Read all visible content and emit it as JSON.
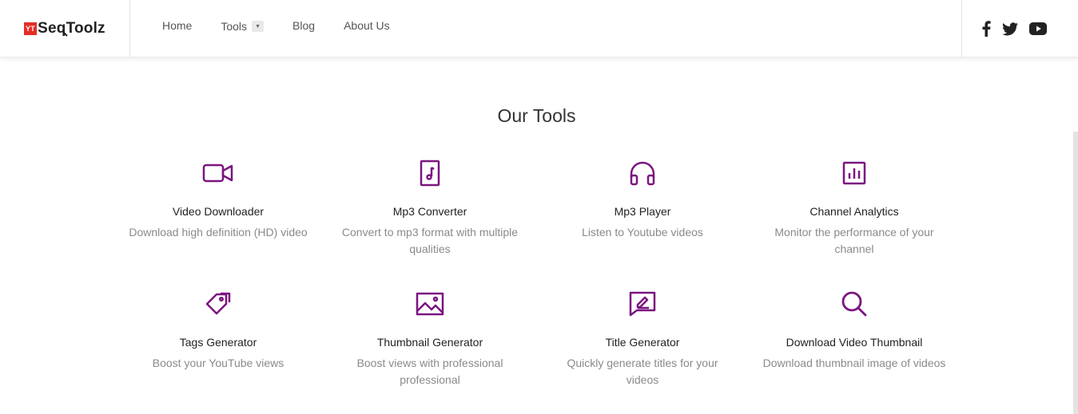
{
  "brand": {
    "badge": "YT",
    "name_start": "Se",
    "name_q": "q",
    "name_end": "Toolz"
  },
  "nav": {
    "home": "Home",
    "tools": "Tools",
    "blog": "Blog",
    "about": "About Us"
  },
  "social": {
    "facebook": "facebook-icon",
    "twitter": "twitter-icon",
    "youtube": "youtube-icon"
  },
  "section_title": "Our Tools",
  "accent_color": "#7b1580",
  "tools": [
    {
      "name": "Video Downloader",
      "desc": "Download high definition (HD) video",
      "icon": "video-camera-icon"
    },
    {
      "name": "Mp3 Converter",
      "desc": "Convert to mp3 format with multiple qualities",
      "icon": "music-file-icon"
    },
    {
      "name": "Mp3 Player",
      "desc": "Listen to Youtube videos",
      "icon": "headphones-icon"
    },
    {
      "name": "Channel Analytics",
      "desc": "Monitor the performance of your channel",
      "icon": "bar-chart-icon"
    },
    {
      "name": "Tags Generator",
      "desc": "Boost your YouTube views",
      "icon": "tags-icon"
    },
    {
      "name": "Thumbnail Generator",
      "desc": "Boost views with professional professional",
      "icon": "image-icon"
    },
    {
      "name": "Title Generator",
      "desc": "Quickly generate titles for your videos",
      "icon": "edit-message-icon"
    },
    {
      "name": "Download Video Thumbnail",
      "desc": "Download thumbnail image of videos",
      "icon": "search-icon"
    }
  ]
}
